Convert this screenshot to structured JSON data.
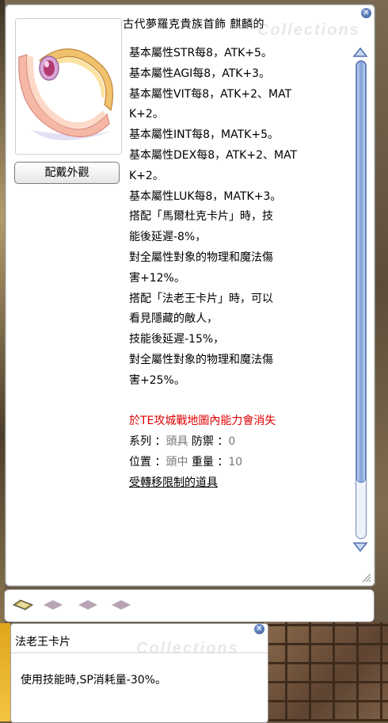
{
  "item": {
    "name": "古代夢羅克貴族首飾 麒麟的",
    "watermark": "Collections",
    "appearance_button": "配戴外觀",
    "description": [
      {
        "text": "基本屬性STR每8，ATK+5。",
        "style": ""
      },
      {
        "text": "基本屬性AGI每8，ATK+3。",
        "style": ""
      },
      {
        "text": "基本屬性VIT每8，ATK+2、MAT",
        "style": ""
      },
      {
        "text": "K+2。",
        "style": ""
      },
      {
        "text": "基本屬性INT每8，MATK+5。",
        "style": ""
      },
      {
        "text": "基本屬性DEX每8，ATK+2、MAT",
        "style": ""
      },
      {
        "text": "K+2。",
        "style": ""
      },
      {
        "text": "基本屬性LUK每8，MATK+3。",
        "style": ""
      },
      {
        "text": "搭配「馬爾杜克卡片」時，技",
        "style": ""
      },
      {
        "text": "能後延遲-8%，",
        "style": ""
      },
      {
        "text": "對全屬性對象的物理和魔法傷",
        "style": ""
      },
      {
        "text": "害+12%。",
        "style": ""
      },
      {
        "text": "搭配「法老王卡片」時，可以",
        "style": ""
      },
      {
        "text": "看見隱藏的敵人，",
        "style": ""
      },
      {
        "text": "技能後延遲-15%，",
        "style": ""
      },
      {
        "text": "對全屬性對象的物理和魔法傷",
        "style": ""
      },
      {
        "text": "害+25%。",
        "style": ""
      },
      {
        "text": "",
        "style": ""
      },
      {
        "text": "於TE攻城戰地圖內能力會消失",
        "style": "red"
      }
    ],
    "stats": {
      "type_label": "系列",
      "type_value": "頭具",
      "defense_label": "防禦",
      "defense_value": "0",
      "position_label": "位置",
      "position_value": "頭中",
      "weight_label": "重量",
      "weight_value": "10",
      "colon": "："
    },
    "restriction": "受轉移限制的道具"
  },
  "card": {
    "name": "法老王卡片",
    "watermark": "Collections",
    "description": "使用技能時,SP消耗量-30%。"
  },
  "close_symbol": "⊗"
}
